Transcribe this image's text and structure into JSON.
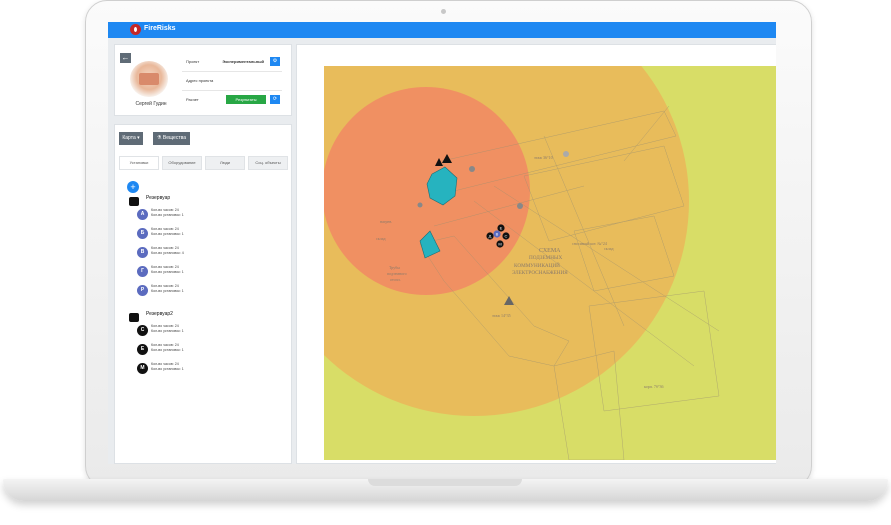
{
  "app": {
    "brand": "FireRisks"
  },
  "user": {
    "name": "Сергей Гудин"
  },
  "project_info": {
    "rows": [
      {
        "label": "Проект",
        "value": "Экспериментальный"
      },
      {
        "label": "Адрес проекта",
        "value": ""
      },
      {
        "label": "Расчет",
        "button": "Результаты"
      }
    ]
  },
  "toolbar": {
    "map_label": "Карта ▾",
    "substances_label": "Вещества"
  },
  "tabs": [
    "Установки",
    "Оборудование",
    "Люди",
    "Соц. объекты"
  ],
  "reservoirs": [
    {
      "name": "Резервуар",
      "items": [
        {
          "letter": "А",
          "hours": "Кол-во часов: 24",
          "installs": "Кол-во установок: 1",
          "color": "#5b6bbf"
        },
        {
          "letter": "Б",
          "hours": "Кол-во часов: 24",
          "installs": "Кол-во установок: 1",
          "color": "#5b6bbf"
        },
        {
          "letter": "В",
          "hours": "Кол-во часов: 24",
          "installs": "Кол-во установок: 4",
          "color": "#5b6bbf"
        },
        {
          "letter": "Г",
          "hours": "Кол-во часов: 24",
          "installs": "Кол-во установок: 1",
          "color": "#5b6bbf"
        },
        {
          "letter": "Р",
          "hours": "Кол-во часов: 24",
          "installs": "Кол-во установок: 1",
          "color": "#5b6bbf"
        }
      ]
    },
    {
      "name": "Резервуар2",
      "items": [
        {
          "letter": "С",
          "hours": "Кол-во часов: 24",
          "installs": "Кол-во установок: 1",
          "color": "#111111"
        },
        {
          "letter": "Е",
          "hours": "Кол-во часов: 24",
          "installs": "Кол-во установок: 1",
          "color": "#111111"
        },
        {
          "letter": "М",
          "hours": "Кол-во часов: 24",
          "installs": "Кол-во установок: 1",
          "color": "#111111"
        }
      ]
    }
  ],
  "map": {
    "labels": [
      "СХЕМА",
      "ПОДЗЕМНЫХ",
      "КОММУНИКАЦИЙ",
      "ЭЛЕКТРОСНАБЖЕНИЯ",
      "Трубы",
      "подземного",
      "отопл.",
      "нагрев.",
      "склад",
      "этаж 14°35",
      "сносимый кот. №°24",
      "этаж 36°10",
      "склад",
      "корп. 7б°36"
    ],
    "markers": [
      "Е",
      "В",
      "Д",
      "С",
      "М"
    ],
    "colors": {
      "outer_zone": "#e9b95b",
      "inner_zone": "#f08d63",
      "background": "#d8dd67",
      "tank": "#26b3bf",
      "accent": "#1e88f2"
    }
  }
}
